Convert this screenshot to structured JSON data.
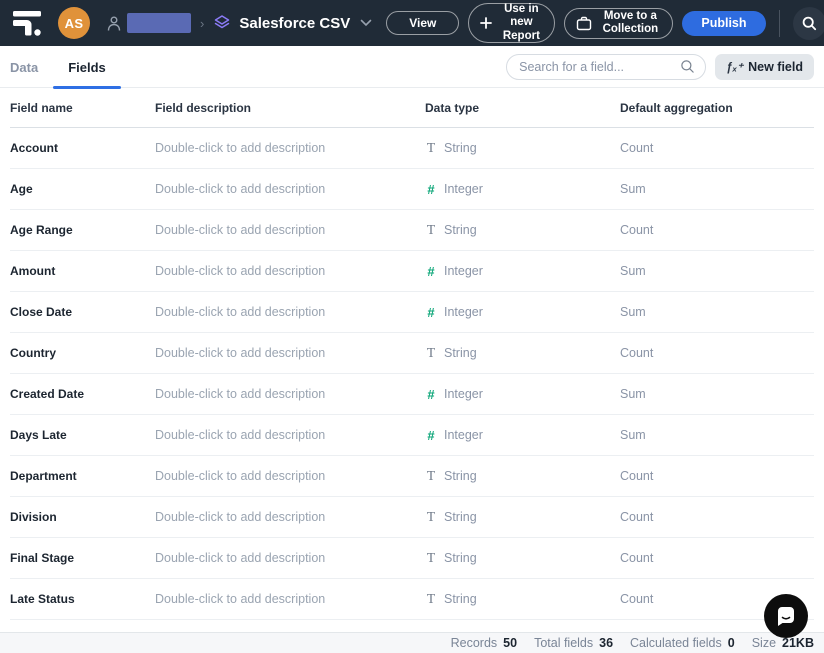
{
  "colors": {
    "navbar_bg": "#202b37",
    "accent_blue": "#2f6fe4",
    "publish_blue": "#2e6ce0",
    "avatar_orange": "#e0923a",
    "redacted_block_blue": "#5a6ab4",
    "dataset_icon_purple": "#8b7bf7",
    "unsaved_dot_blue": "#7b9bf5",
    "integer_icon_green": "#0ca678"
  },
  "navbar": {
    "avatar_initials": "AS",
    "breadcrumb_separator": "›",
    "title": "Salesforce CSV",
    "view_button": "View",
    "use_in_new_report_button": "Use in new Report",
    "move_to_collection_button": "Move to a Collection",
    "publish_button": "Publish"
  },
  "tabs": {
    "data": "Data",
    "fields": "Fields"
  },
  "toolbar": {
    "search_placeholder": "Search for a field...",
    "new_field_icon": "ƒₓ⁺",
    "new_field_label": "New field"
  },
  "table": {
    "columns": {
      "name": "Field name",
      "description": "Field description",
      "type": "Data type",
      "aggregation": "Default aggregation"
    },
    "type_icons": {
      "String": "T",
      "Integer": "#"
    },
    "rows": [
      {
        "name": "Account",
        "description": "Double-click to add description",
        "type": "String",
        "aggregation": "Count"
      },
      {
        "name": "Age",
        "description": "Double-click to add description",
        "type": "Integer",
        "aggregation": "Sum"
      },
      {
        "name": "Age Range",
        "description": "Double-click to add description",
        "type": "String",
        "aggregation": "Count"
      },
      {
        "name": "Amount",
        "description": "Double-click to add description",
        "type": "Integer",
        "aggregation": "Sum"
      },
      {
        "name": "Close Date",
        "description": "Double-click to add description",
        "type": "Integer",
        "aggregation": "Sum"
      },
      {
        "name": "Country",
        "description": "Double-click to add description",
        "type": "String",
        "aggregation": "Count"
      },
      {
        "name": "Created Date",
        "description": "Double-click to add description",
        "type": "Integer",
        "aggregation": "Sum"
      },
      {
        "name": "Days Late",
        "description": "Double-click to add description",
        "type": "Integer",
        "aggregation": "Sum"
      },
      {
        "name": "Department",
        "description": "Double-click to add description",
        "type": "String",
        "aggregation": "Count"
      },
      {
        "name": "Division",
        "description": "Double-click to add description",
        "type": "String",
        "aggregation": "Count"
      },
      {
        "name": "Final Stage",
        "description": "Double-click to add description",
        "type": "String",
        "aggregation": "Count"
      },
      {
        "name": "Late Status",
        "description": "Double-click to add description",
        "type": "String",
        "aggregation": "Count"
      }
    ]
  },
  "status_bar": {
    "items": [
      {
        "label": "Records",
        "value": "50"
      },
      {
        "label": "Total fields",
        "value": "36"
      },
      {
        "label": "Calculated fields",
        "value": "0"
      },
      {
        "label": "Size",
        "value": "21KB"
      }
    ]
  }
}
